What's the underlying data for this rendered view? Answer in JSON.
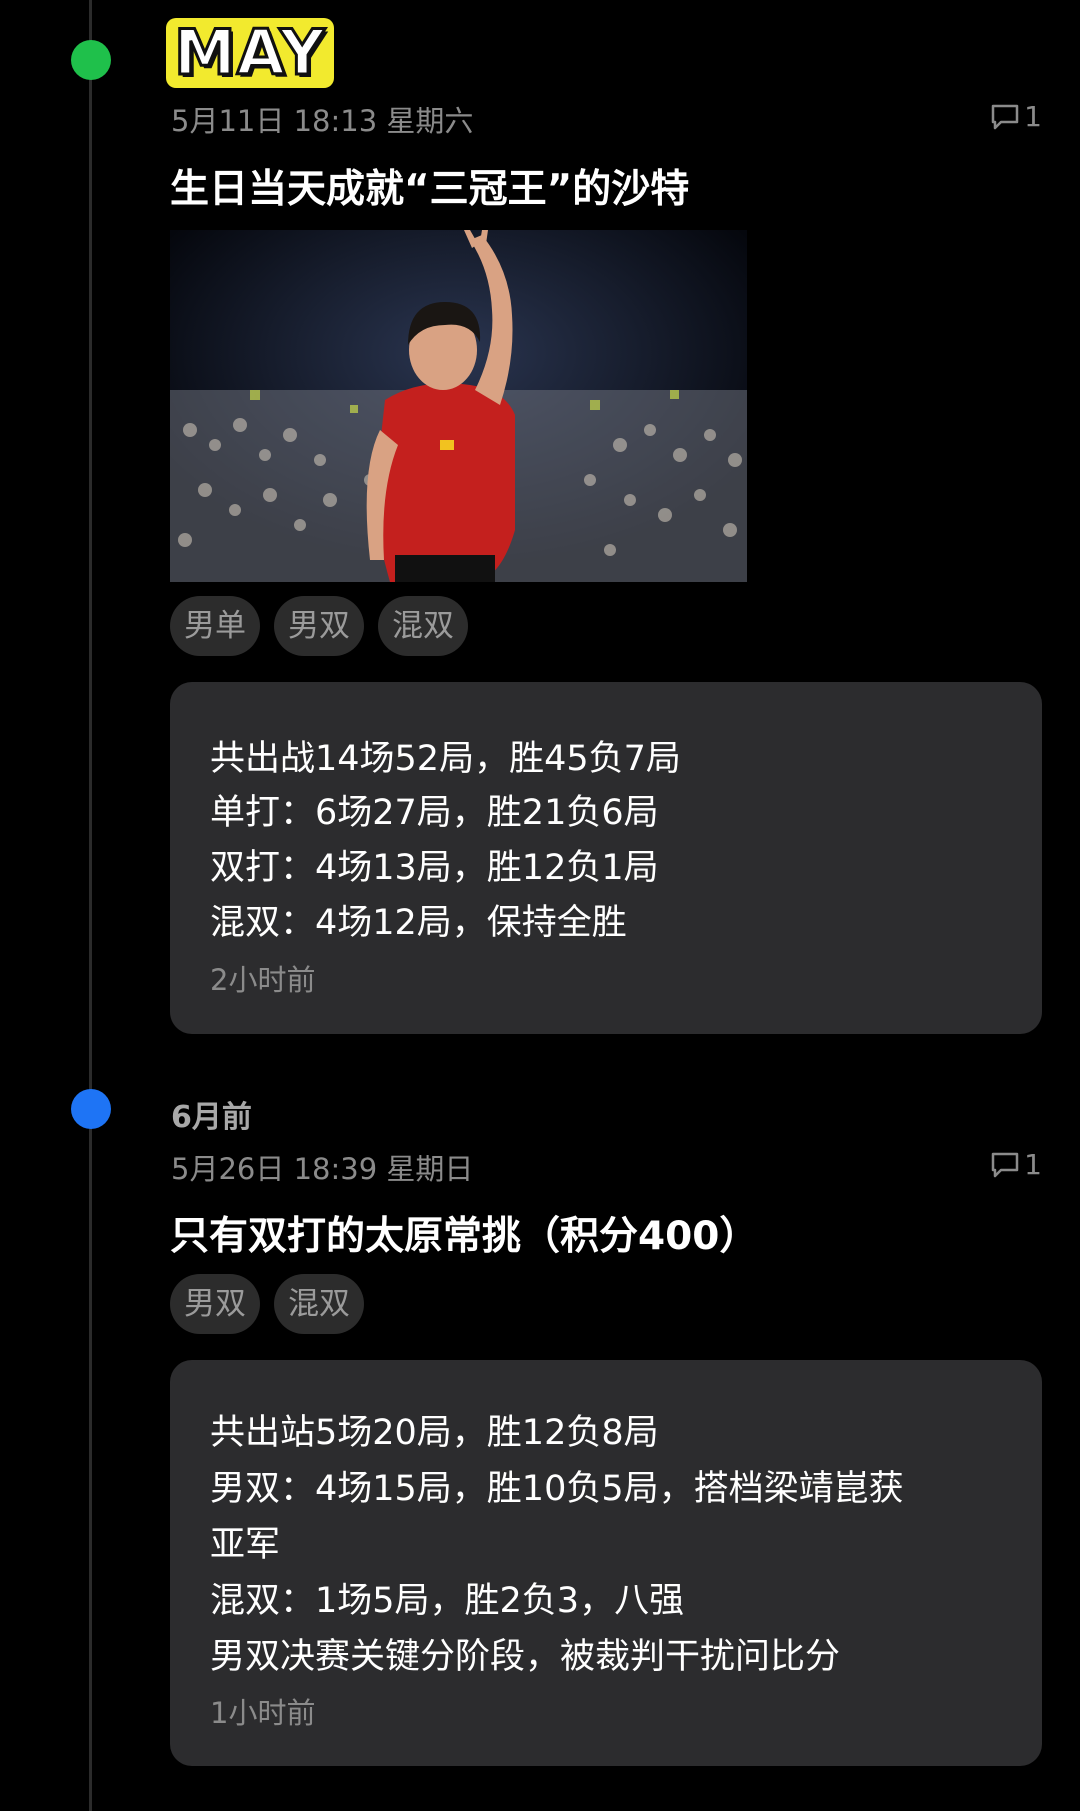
{
  "month_badge": "MAY",
  "entries": [
    {
      "date": "5月11日 18:13 星期六",
      "comments": "1",
      "title": "生日当天成就“三冠王”的沙特",
      "tags": [
        "男单",
        "男双",
        "混双"
      ],
      "card_lines": [
        "共出战14场52局，胜45负7局",
        "单打：6场27局，胜21负6局",
        "双打：4场13局，胜12负1局",
        "混双：4场12局，保持全胜"
      ],
      "time_ago": "2小时前",
      "dot_color": "#1fc04b"
    },
    {
      "section_label": "6月前",
      "date": "5月26日 18:39 星期日",
      "comments": "1",
      "title": "只有双打的太原常挑（积分400）",
      "tags": [
        "男双",
        "混双"
      ],
      "card_lines": [
        "共出站5场20局，胜12负8局",
        "男双：4场15局，胜10负5局，搭档梁靖崑获",
        "亚军",
        "混双：1场5局，胜2负3，八强",
        "男双决赛关键分阶段，被裁判干扰问比分"
      ],
      "time_ago": "1小时前",
      "dot_color": "#1e74f5"
    }
  ]
}
